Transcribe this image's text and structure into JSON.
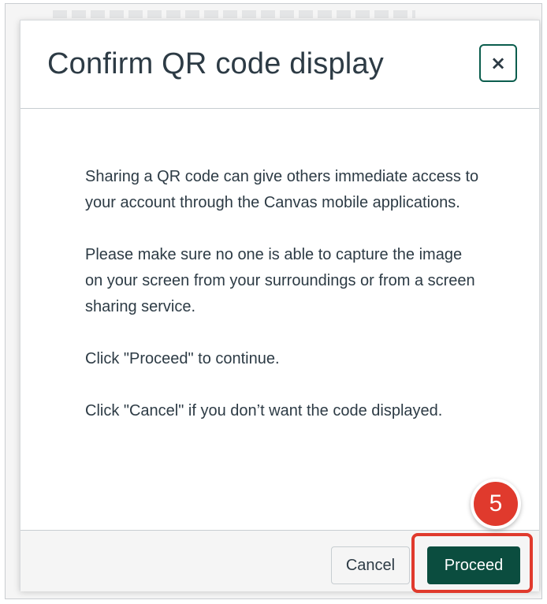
{
  "dialog": {
    "title": "Confirm QR code display",
    "close_icon": "close-icon",
    "body_paragraphs": [
      "Sharing a QR code can give others immediate access to your account through the Canvas mobile applications.",
      "Please make sure no one is able to capture the image on your screen from your surroundings or from a screen sharing service.",
      "Click \"Proceed\" to continue.",
      "Click \"Cancel\" if you don’t want the code displayed."
    ],
    "cancel_label": "Cancel",
    "proceed_label": "Proceed"
  },
  "annotation": {
    "step_number": "5",
    "highlight_color": "#e03a2d"
  },
  "colors": {
    "primary_button": "#0b4d3f",
    "text": "#2d3b45",
    "close_border": "#0b5d4d"
  }
}
